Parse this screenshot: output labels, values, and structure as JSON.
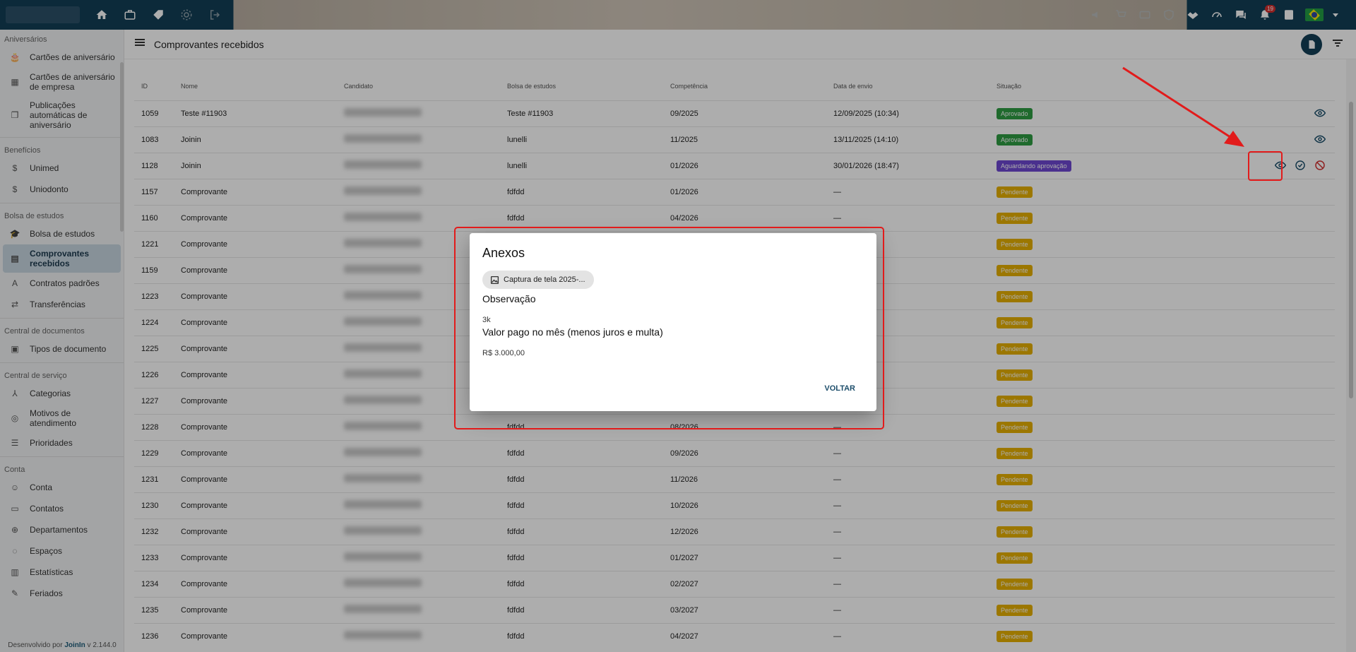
{
  "topbar": {
    "left_icons": [
      "home-icon",
      "briefcase-icon",
      "tag-icon",
      "gear-icon",
      "logout-icon"
    ],
    "right_icons": [
      "megaphone-icon",
      "cart-icon",
      "card-icon",
      "shield-icon",
      "handshake-icon",
      "gauge-icon",
      "chat-icon",
      "bell-icon",
      "id-card-icon"
    ],
    "notification_count": "19"
  },
  "sidebar": {
    "sections": [
      {
        "title": "Aniversários",
        "items": [
          {
            "label": "Cartões de aniversário",
            "icon": "cake-icon"
          },
          {
            "label": "Cartões de aniversário de empresa",
            "icon": "building-icon"
          },
          {
            "label": "Publicações automáticas de aniversário",
            "icon": "copy-icon"
          }
        ]
      },
      {
        "title": "Benefícios",
        "items": [
          {
            "label": "Unimed",
            "icon": "dollar-icon"
          },
          {
            "label": "Uniodonto",
            "icon": "dollar-icon"
          }
        ]
      },
      {
        "title": "Bolsa de estudos",
        "items": [
          {
            "label": "Bolsa de estudos",
            "icon": "graduation-icon"
          },
          {
            "label": "Comprovantes recebidos",
            "icon": "receipt-icon",
            "active": true
          },
          {
            "label": "Contratos padrões",
            "icon": "text-underline-icon"
          },
          {
            "label": "Transferências",
            "icon": "transfer-icon"
          }
        ]
      },
      {
        "title": "Central de documentos",
        "items": [
          {
            "label": "Tipos de documento",
            "icon": "doc-types-icon"
          }
        ]
      },
      {
        "title": "Central de serviço",
        "items": [
          {
            "label": "Categorias",
            "icon": "fork-icon"
          },
          {
            "label": "Motivos de atendimento",
            "icon": "target-icon"
          },
          {
            "label": "Prioridades",
            "icon": "list-icon"
          }
        ]
      },
      {
        "title": "Conta",
        "items": [
          {
            "label": "Conta",
            "icon": "user-circle-icon"
          },
          {
            "label": "Contatos",
            "icon": "contacts-icon"
          },
          {
            "label": "Departamentos",
            "icon": "org-icon"
          },
          {
            "label": "Espaços",
            "icon": "spaces-icon"
          },
          {
            "label": "Estatísticas",
            "icon": "stats-icon"
          },
          {
            "label": "Feriados",
            "icon": "holiday-icon"
          }
        ]
      }
    ],
    "footer_prefix": "Desenvolvido por ",
    "footer_brand": "JoinIn",
    "footer_version": " v 2.144.0"
  },
  "header": {
    "title": "Comprovantes recebidos"
  },
  "table": {
    "columns": [
      "ID",
      "Nome",
      "Candidato",
      "Bolsa de estudos",
      "Competência",
      "Data de envio",
      "Situação"
    ],
    "rows": [
      {
        "id": "1059",
        "nome": "Teste #11903",
        "bolsa": "Teste #11903",
        "competencia": "09/2025",
        "envio": "12/09/2025 (10:34)",
        "situacao": "Aprovado",
        "status": "ok"
      },
      {
        "id": "1083",
        "nome": "Joinin",
        "bolsa": "lunelli",
        "competencia": "11/2025",
        "envio": "13/11/2025 (14:10)",
        "situacao": "Aprovado",
        "status": "ok"
      },
      {
        "id": "1128",
        "nome": "Joinin",
        "bolsa": "lunelli",
        "competencia": "01/2026",
        "envio": "30/01/2026 (18:47)",
        "situacao": "Aguardando aprovação",
        "status": "wait"
      },
      {
        "id": "1157",
        "nome": "Comprovante",
        "bolsa": "fdfdd",
        "competencia": "01/2026",
        "envio": "—",
        "situacao": "Pendente",
        "status": "pend"
      },
      {
        "id": "1160",
        "nome": "Comprovante",
        "bolsa": "fdfdd",
        "competencia": "04/2026",
        "envio": "—",
        "situacao": "Pendente",
        "status": "pend"
      },
      {
        "id": "1221",
        "nome": "Comprovante",
        "bolsa": "",
        "competencia": "",
        "envio": "",
        "situacao": "Pendente",
        "status": "pend"
      },
      {
        "id": "1159",
        "nome": "Comprovante",
        "bolsa": "",
        "competencia": "",
        "envio": "",
        "situacao": "Pendente",
        "status": "pend"
      },
      {
        "id": "1223",
        "nome": "Comprovante",
        "bolsa": "",
        "competencia": "",
        "envio": "",
        "situacao": "Pendente",
        "status": "pend"
      },
      {
        "id": "1224",
        "nome": "Comprovante",
        "bolsa": "",
        "competencia": "",
        "envio": "",
        "situacao": "Pendente",
        "status": "pend"
      },
      {
        "id": "1225",
        "nome": "Comprovante",
        "bolsa": "",
        "competencia": "",
        "envio": "",
        "situacao": "Pendente",
        "status": "pend"
      },
      {
        "id": "1226",
        "nome": "Comprovante",
        "bolsa": "",
        "competencia": "",
        "envio": "",
        "situacao": "Pendente",
        "status": "pend"
      },
      {
        "id": "1227",
        "nome": "Comprovante",
        "bolsa": "",
        "competencia": "",
        "envio": "",
        "situacao": "Pendente",
        "status": "pend"
      },
      {
        "id": "1228",
        "nome": "Comprovante",
        "bolsa": "fdfdd",
        "competencia": "08/2026",
        "envio": "—",
        "situacao": "Pendente",
        "status": "pend"
      },
      {
        "id": "1229",
        "nome": "Comprovante",
        "bolsa": "fdfdd",
        "competencia": "09/2026",
        "envio": "—",
        "situacao": "Pendente",
        "status": "pend"
      },
      {
        "id": "1231",
        "nome": "Comprovante",
        "bolsa": "fdfdd",
        "competencia": "11/2026",
        "envio": "—",
        "situacao": "Pendente",
        "status": "pend"
      },
      {
        "id": "1230",
        "nome": "Comprovante",
        "bolsa": "fdfdd",
        "competencia": "10/2026",
        "envio": "—",
        "situacao": "Pendente",
        "status": "pend"
      },
      {
        "id": "1232",
        "nome": "Comprovante",
        "bolsa": "fdfdd",
        "competencia": "12/2026",
        "envio": "—",
        "situacao": "Pendente",
        "status": "pend"
      },
      {
        "id": "1233",
        "nome": "Comprovante",
        "bolsa": "fdfdd",
        "competencia": "01/2027",
        "envio": "—",
        "situacao": "Pendente",
        "status": "pend"
      },
      {
        "id": "1234",
        "nome": "Comprovante",
        "bolsa": "fdfdd",
        "competencia": "02/2027",
        "envio": "—",
        "situacao": "Pendente",
        "status": "pend"
      },
      {
        "id": "1235",
        "nome": "Comprovante",
        "bolsa": "fdfdd",
        "competencia": "03/2027",
        "envio": "—",
        "situacao": "Pendente",
        "status": "pend"
      },
      {
        "id": "1236",
        "nome": "Comprovante",
        "bolsa": "fdfdd",
        "competencia": "04/2027",
        "envio": "—",
        "situacao": "Pendente",
        "status": "pend"
      }
    ]
  },
  "dialog": {
    "title": "Anexos",
    "attachment_name": "Captura de tela 2025-...",
    "observacao_label": "Observação",
    "observacao_value": "3k",
    "valor_label": "Valor pago no mês (menos juros e multa)",
    "valor_value": "R$ 3.000,00",
    "back_button": "VOLTAR"
  },
  "colors": {
    "primary": "#123e56",
    "approved": "#2e9c43",
    "waiting": "#6e48d1",
    "pending": "#e6b000",
    "annotation": "#e21b1b"
  }
}
